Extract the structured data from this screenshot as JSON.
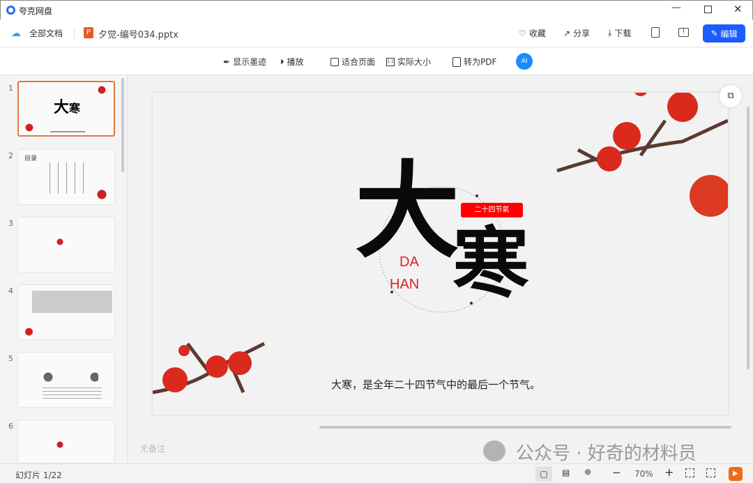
{
  "app": {
    "title": "夸克网盘",
    "window_controls": [
      "minimize",
      "maximize",
      "close"
    ]
  },
  "header": {
    "all_docs": "全部文档",
    "file_name": "夕觉-编号034.pptx",
    "favorite": "收藏",
    "share": "分享",
    "download": "下载",
    "edit": "编辑"
  },
  "toolbar": {
    "show_ink": "显示墨迹",
    "play": "播放",
    "fit_page": "适合页面",
    "actual_size": "实际大小",
    "to_pdf": "转为PDF",
    "ai": "AI"
  },
  "slides": {
    "numbers": [
      "1",
      "2",
      "3",
      "4",
      "5",
      "6"
    ],
    "selected": 1,
    "thumb2_title": "目录"
  },
  "slide": {
    "title_big1": "大",
    "title_big2": "寒",
    "badge": "二十四节氣",
    "pinyin1": "DA",
    "pinyin2": "HAN",
    "caption": "大寒，是全年二十四节气中的最后一个节气。"
  },
  "notes": {
    "placeholder": "无备注"
  },
  "watermark": "公众号 · 好奇的材料员",
  "status": {
    "slide_counter": "幻灯片 1/22",
    "zoom": "70%"
  },
  "colors": {
    "accent": "#1a5cff",
    "selected_border": "#e07a3a",
    "badge": "#ff0000"
  }
}
